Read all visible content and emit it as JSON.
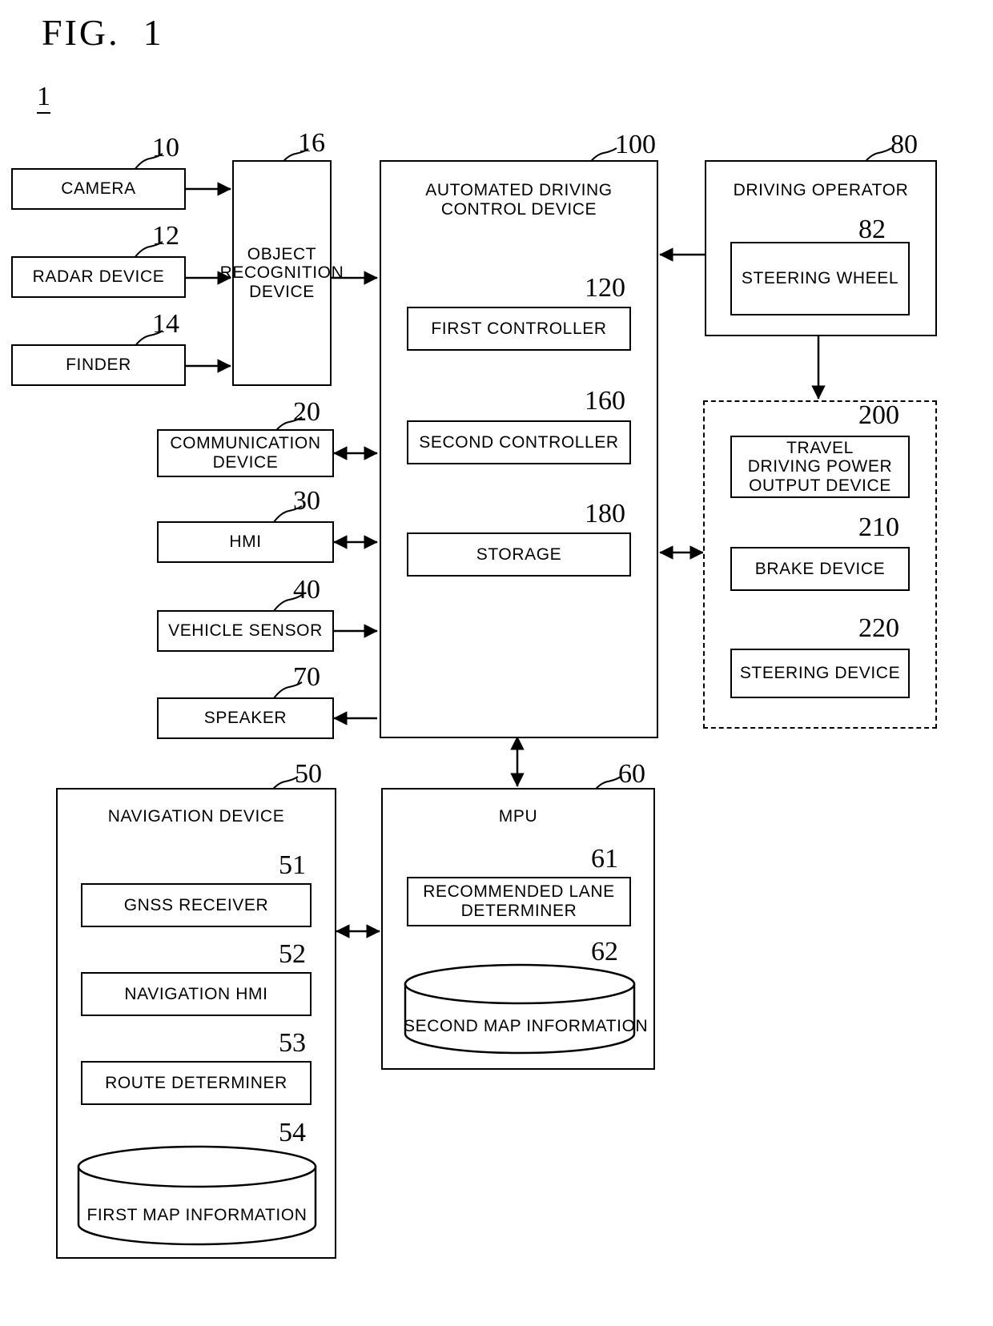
{
  "figure": {
    "title": "FIG.  1",
    "system_ref": "1"
  },
  "nodes": {
    "camera": {
      "label": "CAMERA",
      "ref": "10"
    },
    "radar_device": {
      "label": "RADAR DEVICE",
      "ref": "12"
    },
    "finder": {
      "label": "FINDER",
      "ref": "14"
    },
    "object_recognition": {
      "label": "OBJECT\nRECOGNITION\nDEVICE",
      "ref": "16"
    },
    "communication_device": {
      "label": "COMMUNICATION\nDEVICE",
      "ref": "20"
    },
    "hmi": {
      "label": "HMI",
      "ref": "30"
    },
    "vehicle_sensor": {
      "label": "VEHICLE SENSOR",
      "ref": "40"
    },
    "speaker": {
      "label": "SPEAKER",
      "ref": "70"
    },
    "automated_driving": {
      "label": "AUTOMATED DRIVING\nCONTROL DEVICE",
      "ref": "100"
    },
    "first_controller": {
      "label": "FIRST CONTROLLER",
      "ref": "120"
    },
    "second_controller": {
      "label": "SECOND CONTROLLER",
      "ref": "160"
    },
    "storage": {
      "label": "STORAGE",
      "ref": "180"
    },
    "driving_operator": {
      "label": "DRIVING OPERATOR",
      "ref": "80"
    },
    "steering_wheel": {
      "label": "STEERING WHEEL",
      "ref": "82"
    },
    "travel_power": {
      "label": "TRAVEL\nDRIVING POWER\nOUTPUT DEVICE",
      "ref": "200"
    },
    "brake_device": {
      "label": "BRAKE DEVICE",
      "ref": "210"
    },
    "steering_device": {
      "label": "STEERING DEVICE",
      "ref": "220"
    },
    "navigation_device": {
      "label": "NAVIGATION DEVICE",
      "ref": "50"
    },
    "gnss_receiver": {
      "label": "GNSS RECEIVER",
      "ref": "51"
    },
    "navigation_hmi": {
      "label": "NAVIGATION HMI",
      "ref": "52"
    },
    "route_determiner": {
      "label": "ROUTE DETERMINER",
      "ref": "53"
    },
    "first_map_info": {
      "label": "FIRST MAP INFORMATION",
      "ref": "54"
    },
    "mpu": {
      "label": "MPU",
      "ref": "60"
    },
    "recommended_lane": {
      "label": "RECOMMENDED LANE\nDETERMINER",
      "ref": "61"
    },
    "second_map_info": {
      "label": "SECOND MAP INFORMATION",
      "ref": "62"
    }
  },
  "colors": {
    "stroke": "#000000",
    "background": "#ffffff"
  }
}
